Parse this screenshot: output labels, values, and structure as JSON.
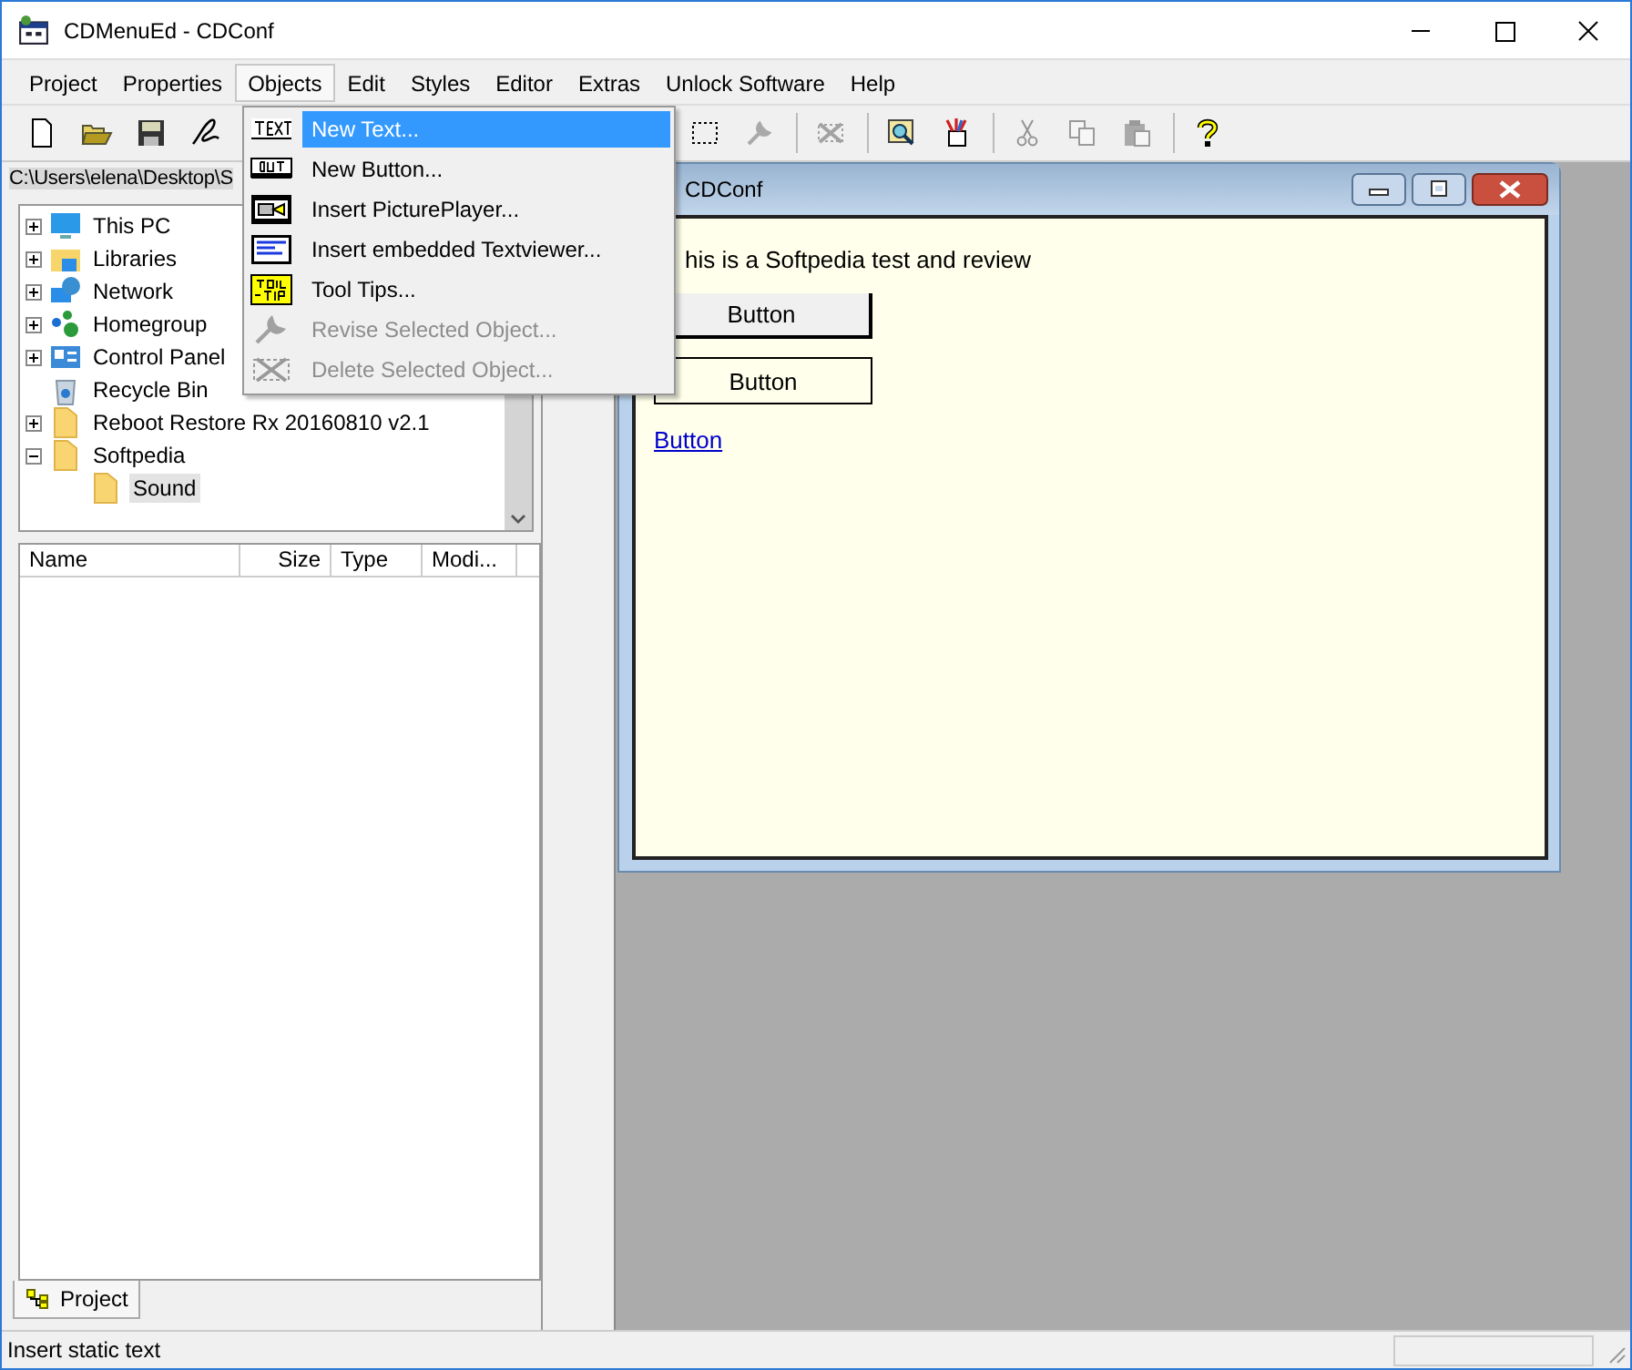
{
  "window": {
    "title": "CDMenuEd - CDConf"
  },
  "menubar": [
    {
      "label": "Project",
      "selected": false
    },
    {
      "label": "Properties",
      "selected": false
    },
    {
      "label": "Objects",
      "selected": true
    },
    {
      "label": "Edit",
      "selected": false
    },
    {
      "label": "Styles",
      "selected": false
    },
    {
      "label": "Editor",
      "selected": false
    },
    {
      "label": "Extras",
      "selected": false
    },
    {
      "label": "Unlock Software",
      "selected": false
    },
    {
      "label": "Help",
      "selected": false
    }
  ],
  "toolbar": {
    "left": [
      {
        "kind": "new",
        "disabled": false
      },
      {
        "kind": "open",
        "disabled": false
      },
      {
        "kind": "save",
        "disabled": false
      },
      {
        "kind": "sign",
        "disabled": false
      }
    ],
    "right": [
      {
        "kind": "select",
        "disabled": false
      },
      {
        "kind": "wrench",
        "disabled": true
      },
      {
        "kind": "sep"
      },
      {
        "kind": "delete",
        "disabled": true
      },
      {
        "kind": "sep"
      },
      {
        "kind": "preview",
        "disabled": false
      },
      {
        "kind": "pencils",
        "disabled": false
      },
      {
        "kind": "sep"
      },
      {
        "kind": "cut",
        "disabled": true
      },
      {
        "kind": "copy",
        "disabled": true
      },
      {
        "kind": "paste",
        "disabled": true
      },
      {
        "kind": "sep"
      },
      {
        "kind": "help",
        "disabled": false
      }
    ]
  },
  "objects_menu": [
    {
      "label": "New Text...",
      "kind": "text",
      "selected": true,
      "disabled": false
    },
    {
      "label": "New Button...",
      "kind": "button",
      "selected": false,
      "disabled": false
    },
    {
      "label": "Insert PicturePlayer...",
      "kind": "player",
      "selected": false,
      "disabled": false
    },
    {
      "label": "Insert embedded Textviewer...",
      "kind": "viewer",
      "selected": false,
      "disabled": false
    },
    {
      "label": "Tool Tips...",
      "kind": "tooltip",
      "selected": false,
      "disabled": false
    },
    {
      "label": "Revise Selected Object...",
      "kind": "revise",
      "selected": false,
      "disabled": true
    },
    {
      "label": "Delete Selected Object...",
      "kind": "delete",
      "selected": false,
      "disabled": true
    }
  ],
  "path": "C:\\Users\\elena\\Desktop\\S",
  "tree": [
    {
      "label": "This PC",
      "kind": "pc",
      "expanded": false,
      "selected": false
    },
    {
      "label": "Libraries",
      "kind": "libraries",
      "expanded": false,
      "selected": false
    },
    {
      "label": "Network",
      "kind": "network",
      "expanded": false,
      "selected": false
    },
    {
      "label": "Homegroup",
      "kind": "homegroup",
      "expanded": false,
      "selected": false
    },
    {
      "label": "Control Panel",
      "kind": "control",
      "expanded": false,
      "selected": false
    },
    {
      "label": "Recycle Bin",
      "kind": "bin",
      "selected": false
    },
    {
      "label": "Reboot Restore Rx 20160810 v2.1",
      "kind": "folder",
      "expanded": false,
      "selected": false
    },
    {
      "label": "Softpedia",
      "kind": "folder",
      "expanded": true,
      "selected": false,
      "children": [
        {
          "label": "Sound",
          "selected": true
        }
      ]
    }
  ],
  "file_list": {
    "columns": [
      "Name",
      "Size",
      "Type",
      "Modi..."
    ]
  },
  "bottom_tab": {
    "label": "Project"
  },
  "child_window": {
    "title": "CDConf",
    "text": "his is a Softpedia test and review",
    "items": [
      {
        "kind": "button",
        "label": "Button"
      },
      {
        "kind": "flat-button",
        "label": "Button"
      },
      {
        "kind": "link",
        "label": "Button"
      }
    ]
  },
  "status_bar": {
    "text": "Insert static text"
  }
}
